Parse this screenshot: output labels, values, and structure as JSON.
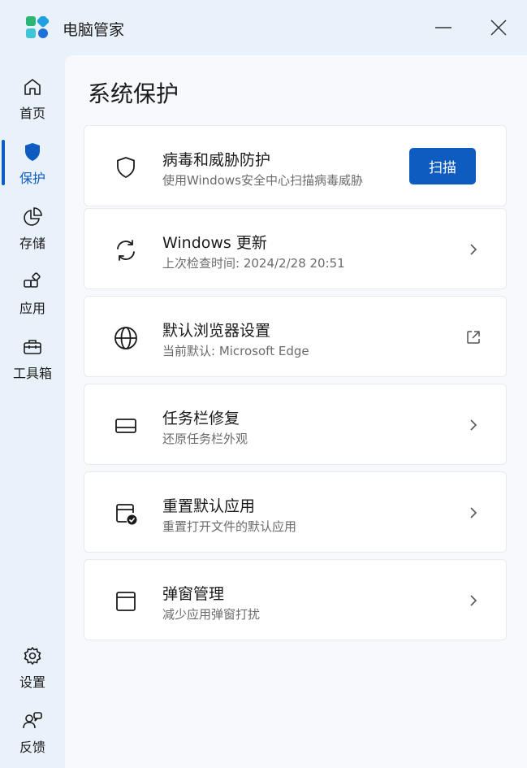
{
  "app": {
    "title": "电脑管家",
    "icon": "app-logo-icon"
  },
  "window_controls": {
    "minimize_icon": "minimize-icon",
    "close_icon": "close-icon"
  },
  "colors": {
    "accent": "#0f5cc0",
    "sidebar_bg": "#e9f2fa",
    "content_bg": "#f7f9fc"
  },
  "sidebar": {
    "items": [
      {
        "label": "首页",
        "icon": "home-icon",
        "active": false
      },
      {
        "label": "保护",
        "icon": "shield-icon",
        "active": true
      },
      {
        "label": "存储",
        "icon": "pie-chart-icon",
        "active": false
      },
      {
        "label": "应用",
        "icon": "apps-icon",
        "active": false
      },
      {
        "label": "工具箱",
        "icon": "toolbox-icon",
        "active": false
      }
    ],
    "bottom_items": [
      {
        "label": "设置",
        "icon": "gear-icon"
      },
      {
        "label": "反馈",
        "icon": "feedback-icon"
      }
    ]
  },
  "main": {
    "title": "系统保护",
    "cards": [
      {
        "title": "病毒和威胁防护",
        "subtitle": "使用Windows安全中心扫描病毒威胁",
        "icon": "shield-outline-icon",
        "action": "button",
        "button_label": "扫描"
      },
      {
        "title": "Windows 更新",
        "subtitle": "上次检查时间: 2024/2/28 20:51",
        "icon": "sync-icon",
        "action": "chevron-right-icon"
      },
      {
        "title": "默认浏览器设置",
        "subtitle": "当前默认: Microsoft Edge",
        "icon": "globe-icon",
        "action": "external-link-icon"
      },
      {
        "title": "任务栏修复",
        "subtitle": "还原任务栏外观",
        "icon": "taskbar-icon",
        "action": "chevron-right-icon"
      },
      {
        "title": "重置默认应用",
        "subtitle": "重置打开文件的默认应用",
        "icon": "window-check-icon",
        "action": "chevron-right-icon"
      },
      {
        "title": "弹窗管理",
        "subtitle": "减少应用弹窗打扰",
        "icon": "popup-window-icon",
        "action": "chevron-right-icon"
      }
    ]
  }
}
